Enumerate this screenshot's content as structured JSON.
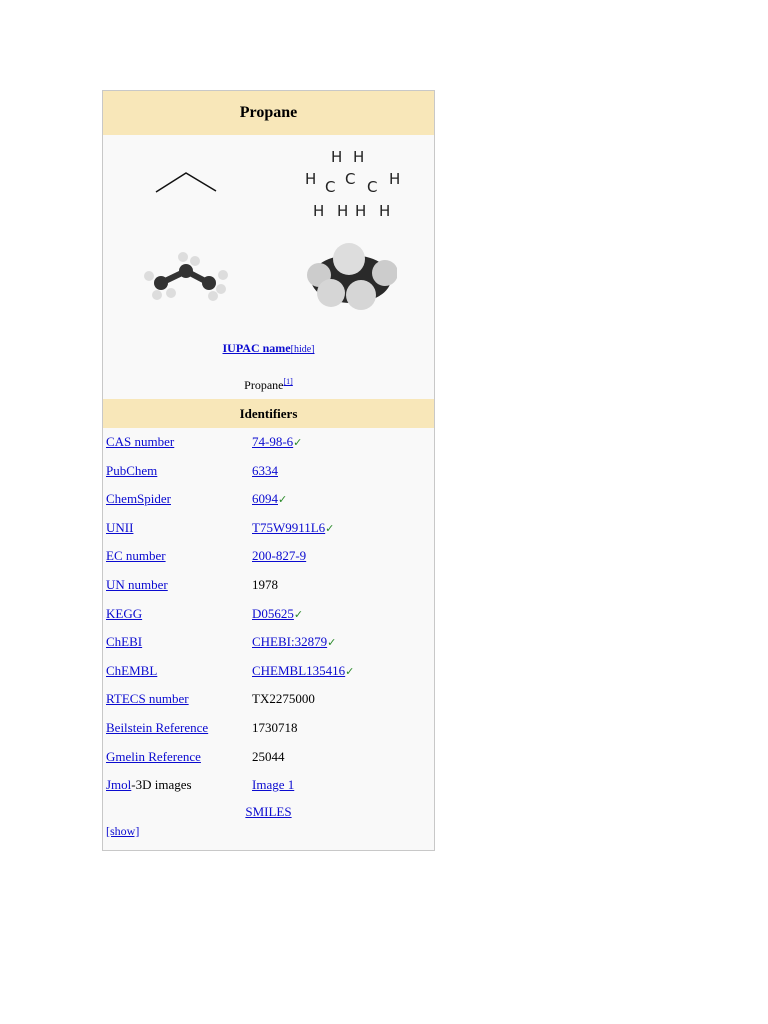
{
  "title": "Propane",
  "iupac": {
    "label": "IUPAC name",
    "toggle": "[hide]",
    "value": "Propane",
    "ref": "[1]"
  },
  "identifiers_header": "Identifiers",
  "rows": [
    {
      "key": "CAS number",
      "value": "74-98-6",
      "value_link": true,
      "check": true
    },
    {
      "key": "PubChem",
      "value": "6334",
      "value_link": true,
      "check": false
    },
    {
      "key": "ChemSpider",
      "value": "6094",
      "value_link": true,
      "check": true
    },
    {
      "key": "UNII",
      "value": "T75W9911L6",
      "value_link": true,
      "check": true
    },
    {
      "key": "EC number",
      "value": "200-827-9",
      "value_link": true,
      "check": false
    },
    {
      "key": "UN number",
      "value": "1978",
      "value_link": false,
      "check": false
    },
    {
      "key": "KEGG",
      "value": "D05625",
      "value_link": true,
      "check": true
    },
    {
      "key": "ChEBI",
      "value": "CHEBI:32879",
      "value_link": true,
      "check": true
    },
    {
      "key": "ChEMBL",
      "value": "CHEMBL135416",
      "value_link": true,
      "check": true
    },
    {
      "key": "RTECS number",
      "value": "TX2275000",
      "value_link": false,
      "check": false
    },
    {
      "key": "Beilstein Reference",
      "value": "1730718",
      "value_link": false,
      "check": false
    },
    {
      "key": "Gmelin Reference",
      "value": "25044",
      "value_link": false,
      "check": false
    }
  ],
  "jmol": {
    "link": "Jmol",
    "suffix": "-3D images",
    "value": "Image 1"
  },
  "smiles": "SMILES",
  "show": "[show]",
  "check_glyph": "✓"
}
